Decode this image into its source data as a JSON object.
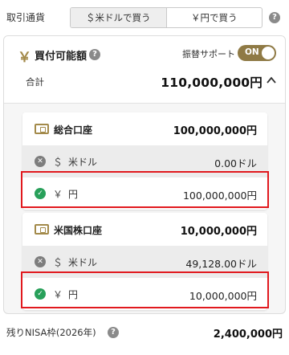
{
  "header": {
    "currency_label": "取引通貨",
    "toggle_usd": "＄米ドルで買う",
    "toggle_jpy": "￥円で買う",
    "help": "?"
  },
  "buying_power": {
    "icon": "￥",
    "title": "買付可能額",
    "help": "?",
    "transfer_support_label": "振替サポート",
    "transfer_support_state": "ON",
    "total_label": "合計",
    "total_value": "110,000,000円"
  },
  "accounts": [
    {
      "name": "総合口座",
      "total": "100,000,000円",
      "rows": [
        {
          "status_icon": "x-circle-icon",
          "symbol": "＄",
          "currency": "米ドル",
          "amount": "0.00ドル"
        },
        {
          "status_icon": "check-circle-icon",
          "symbol": "￥",
          "currency": "円",
          "amount": "100,000,000円"
        }
      ]
    },
    {
      "name": "米国株口座",
      "total": "10,000,000円",
      "rows": [
        {
          "status_icon": "x-circle-icon",
          "symbol": "＄",
          "currency": "米ドル",
          "amount": "49,128.00ドル"
        },
        {
          "status_icon": "check-circle-icon",
          "symbol": "￥",
          "currency": "円",
          "amount": "10,000,000円"
        }
      ]
    }
  ],
  "nisa": {
    "label": "残りNISA枠(2026年)",
    "help": "?",
    "value": "2,400,000円"
  },
  "colors": {
    "accent_gold": "#a38a4a",
    "toggle_bg": "#8f7a45",
    "ok_green": "#28a05a",
    "highlight_red": "#e1191e"
  }
}
